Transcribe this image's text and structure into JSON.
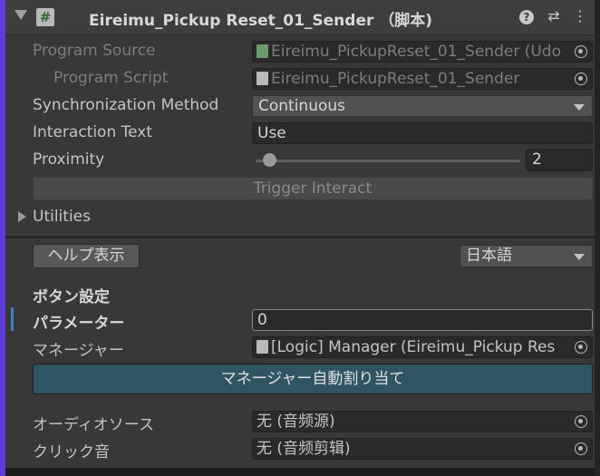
{
  "header": {
    "title": "Eireimu_Pickup Reset_01_Sender （脚本)",
    "script_icon_glyph": "#",
    "help_icon": "?",
    "preset_icon": "⇄",
    "menu_icon": "⋮"
  },
  "program_source": {
    "label": "Program Source",
    "value": "Eireimu_PickupReset_01_Sender (Udo"
  },
  "program_script": {
    "label": "Program Script",
    "value": "Eireimu_PickupReset_01_Sender"
  },
  "sync_method": {
    "label": "Synchronization Method",
    "value": "Continuous"
  },
  "interaction_text": {
    "label": "Interaction Text",
    "value": "Use"
  },
  "proximity": {
    "label": "Proximity",
    "value": "2",
    "slider_fraction": 0.03
  },
  "trigger_button": {
    "label": "Trigger Interact"
  },
  "utilities": {
    "label": "Utilities"
  },
  "help_button": {
    "label": "ヘルプ表示"
  },
  "language": {
    "value": "日本語"
  },
  "section": {
    "title": "ボタン設定"
  },
  "parameter": {
    "label": "パラメーター",
    "value": "0"
  },
  "manager": {
    "label": "マネージャー",
    "value": "[Logic] Manager (Eireimu_Pickup Res"
  },
  "auto_assign_button": {
    "label": "マネージャー自動割り当て"
  },
  "audio_source": {
    "label": "オーディオソース",
    "value": "无 (音频源)"
  },
  "click_sound": {
    "label": "クリック音",
    "value": "无 (音频剪辑)"
  },
  "colors": {
    "accent_bar": "#5d3dd6",
    "auto_assign_button_bg": "#2e5561",
    "selection_marker": "#3b82c4"
  }
}
